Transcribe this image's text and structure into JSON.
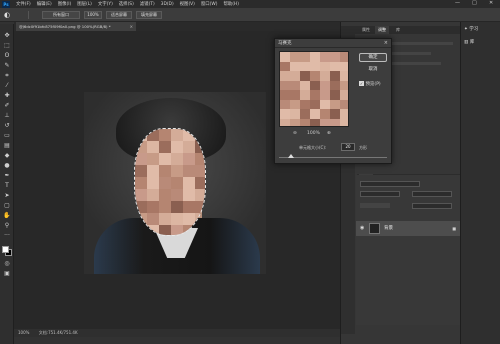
{
  "menubar": {
    "logo": "Ps",
    "items": [
      "文件(F)",
      "编辑(E)",
      "图像(I)",
      "图层(L)",
      "文字(Y)",
      "选择(S)",
      "滤镜(T)",
      "3D(D)",
      "视图(V)",
      "窗口(W)",
      "帮助(H)"
    ],
    "minimize": "—",
    "maximize": "□",
    "close": "✕"
  },
  "options": {
    "tool_icon": "◐",
    "btn1": "所有窗口",
    "btn2": "100%",
    "btn3": "适合屏幕",
    "btn4": "填充屏幕"
  },
  "document": {
    "tab_label": "@J6dc0f91bfc875f09f0a0.png @ 100%(RGB/8) *",
    "tab_close": "×",
    "status_zoom": "100%",
    "status_doc": "文档:751.4K/751.4K"
  },
  "dialog": {
    "title": "马赛克",
    "close": "×",
    "ok_label": "确定",
    "cancel_label": "取消",
    "preview_label": "预览(P)",
    "preview_checked": true,
    "zoom_out": "⊖",
    "zoom_level": "100%",
    "zoom_in": "⊕",
    "cell_size_label": "单元格大小(C):",
    "cell_size_value": "20",
    "cell_size_unit": "方形",
    "slider_level": 0.11
  },
  "right_panels": {
    "top_tabs": [
      "属性",
      "调整",
      "库"
    ],
    "layers_tabs": [
      "图层",
      "通道",
      "路径"
    ],
    "layer_name": "背景",
    "lock_icon": "🔒"
  },
  "far_right": {
    "learn": "学习",
    "libraries": "库"
  },
  "colors": {
    "accent": "#31a8ff",
    "panel_bg": "#363636",
    "canvas_bg": "#282828"
  }
}
